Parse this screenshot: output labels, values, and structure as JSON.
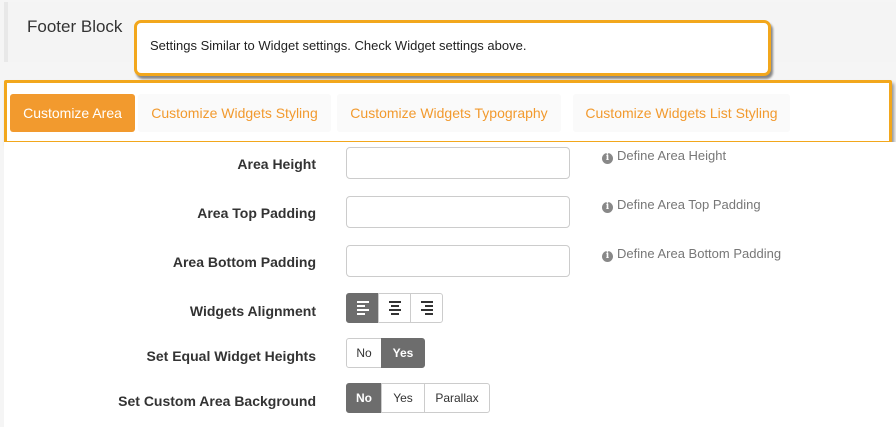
{
  "header": {
    "title": "Footer Block"
  },
  "callout": {
    "text": "Settings Similar to Widget settings. Check Widget settings above."
  },
  "tabs": [
    {
      "label": "Customize Area",
      "active": true
    },
    {
      "label": "Customize Widgets Styling",
      "active": false
    },
    {
      "label": "Customize Widgets Typography",
      "active": false
    },
    {
      "label": "Customize Widgets List Styling",
      "active": false
    }
  ],
  "form": {
    "area_height": {
      "label": "Area Height",
      "value": "",
      "help": "Define Area Height"
    },
    "area_top_padding": {
      "label": "Area Top Padding",
      "value": "",
      "help": "Define Area Top Padding"
    },
    "area_bottom_padding": {
      "label": "Area Bottom Padding",
      "value": "",
      "help": "Define Area Bottom Padding"
    },
    "widgets_alignment": {
      "label": "Widgets Alignment",
      "options": [
        "left",
        "center",
        "right"
      ],
      "selected": "left"
    },
    "equal_heights": {
      "label": "Set Equal Widget Heights",
      "options": [
        "No",
        "Yes"
      ],
      "selected": "Yes"
    },
    "custom_background": {
      "label": "Set Custom Area Background",
      "options": [
        "No",
        "Yes",
        "Parallax"
      ],
      "selected": "No"
    }
  },
  "colors": {
    "accent": "#f29a2e",
    "highlight_border": "#f2a71c",
    "toggle_on": "#6d6d6d"
  },
  "icons": {
    "help": "info-circle-icon"
  }
}
